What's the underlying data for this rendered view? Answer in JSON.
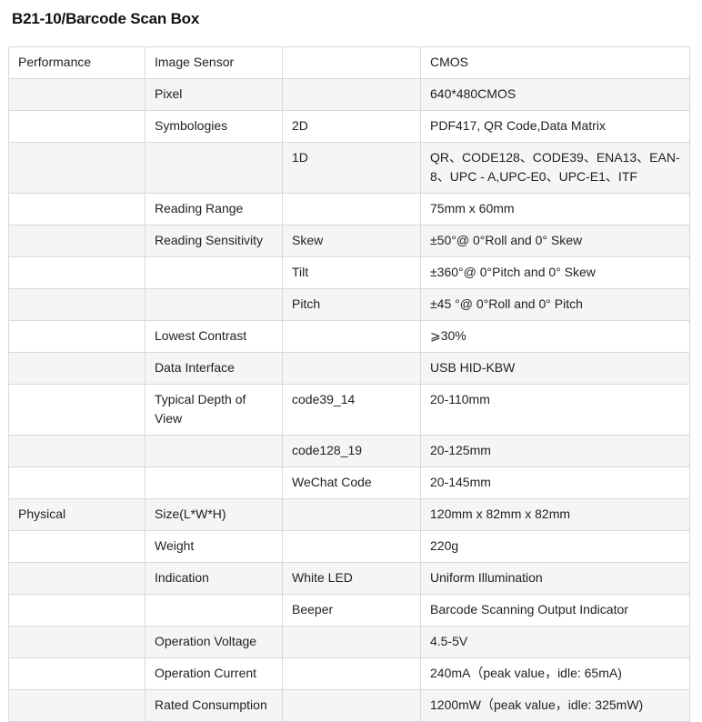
{
  "title": "B21-10/Barcode Scan Box",
  "rows": [
    {
      "section": "Performance",
      "item": "Image Sensor",
      "sub": "",
      "value": "CMOS"
    },
    {
      "section": "",
      "item": "Pixel",
      "sub": "",
      "value": "640*480CMOS"
    },
    {
      "section": "",
      "item": "Symbologies",
      "sub": "2D",
      "value": "PDF417, QR Code,Data Matrix"
    },
    {
      "section": "",
      "item": "",
      "sub": "1D",
      "value": "QR、CODE128、CODE39、ENA13、EAN-8、UPC - A,UPC-E0、UPC-E1、ITF"
    },
    {
      "section": "",
      "item": "Reading Range",
      "sub": "",
      "value": "75mm x 60mm"
    },
    {
      "section": "",
      "item": "Reading Sensitivity",
      "sub": "Skew",
      "value": "±50°@ 0°Roll and 0° Skew"
    },
    {
      "section": "",
      "item": "",
      "sub": "Tilt",
      "value": "±360°@ 0°Pitch and 0° Skew"
    },
    {
      "section": "",
      "item": "",
      "sub": "Pitch",
      "value": "±45 °@ 0°Roll and 0° Pitch"
    },
    {
      "section": "",
      "item": "Lowest Contrast",
      "sub": "",
      "value": "⩾30%"
    },
    {
      "section": "",
      "item": "Data Interface",
      "sub": "",
      "value": "USB HID-KBW"
    },
    {
      "section": "",
      "item": "Typical Depth of View",
      "sub": "code39_14",
      "value": "20-110mm"
    },
    {
      "section": "",
      "item": "",
      "sub": "code128_19",
      "value": "20-125mm"
    },
    {
      "section": "",
      "item": "",
      "sub": "WeChat Code",
      "value": "20-145mm"
    },
    {
      "section": "Physical",
      "item": "Size(L*W*H)",
      "sub": "",
      "value": "120mm x 82mm x 82mm"
    },
    {
      "section": "",
      "item": "Weight",
      "sub": "",
      "value": "220g"
    },
    {
      "section": "",
      "item": "Indication",
      "sub": "White LED",
      "value": "Uniform Illumination"
    },
    {
      "section": "",
      "item": "",
      "sub": "Beeper",
      "value": "Barcode Scanning Output Indicator"
    },
    {
      "section": "",
      "item": "Operation Voltage",
      "sub": "",
      "value": "4.5-5V"
    },
    {
      "section": "",
      "item": "Operation Current",
      "sub": "",
      "value": "240mA（peak value，idle: 65mA)"
    },
    {
      "section": "",
      "item": "Rated Consumption",
      "sub": "",
      "value": "1200mW（peak value，idle: 325mW)"
    }
  ]
}
